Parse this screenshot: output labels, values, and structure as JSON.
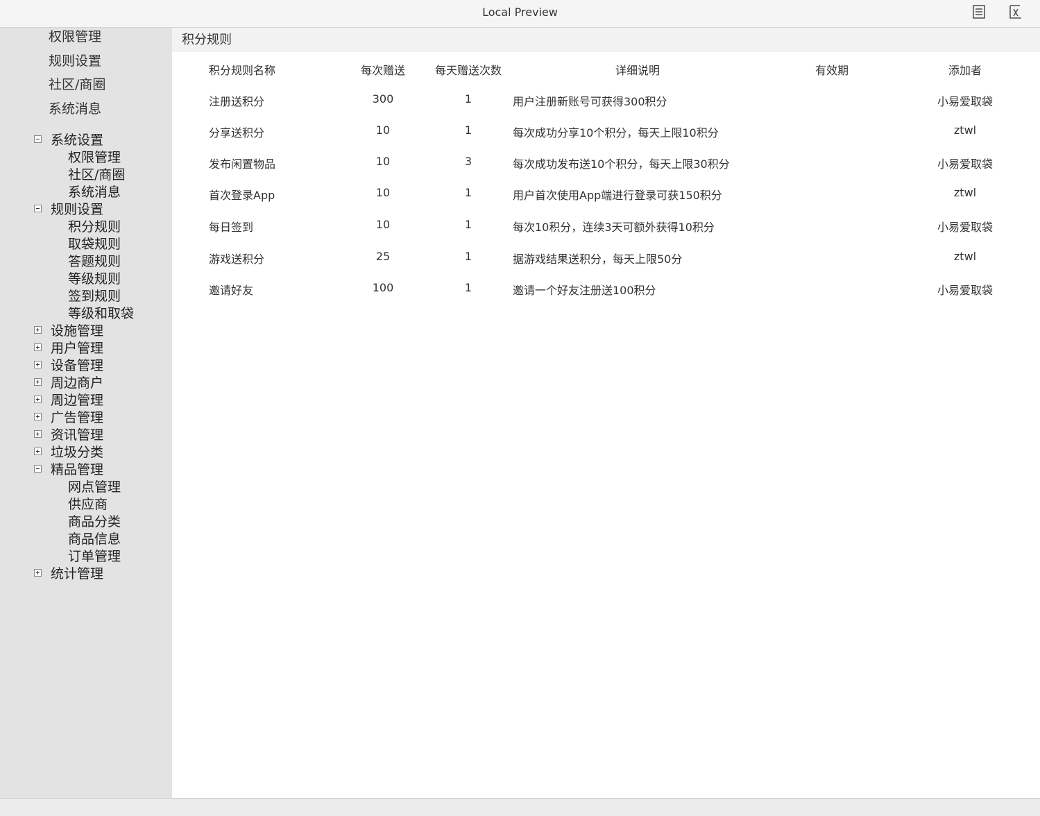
{
  "window": {
    "title": "Local Preview"
  },
  "sidebar": {
    "quick_links": [
      "权限管理",
      "规则设置",
      "社区/商圈",
      "系统消息"
    ],
    "tree": [
      {
        "label": "系统设置",
        "expanded": true,
        "children": [
          "权限管理",
          "社区/商圈",
          "系统消息"
        ]
      },
      {
        "label": "规则设置",
        "expanded": true,
        "children": [
          "积分规则",
          "取袋规则",
          "答题规则",
          "等级规则",
          "签到规则",
          "等级和取袋"
        ]
      },
      {
        "label": "设施管理",
        "expanded": false,
        "children": []
      },
      {
        "label": "用户管理",
        "expanded": false,
        "children": []
      },
      {
        "label": "设备管理",
        "expanded": false,
        "children": []
      },
      {
        "label": "周边商户",
        "expanded": false,
        "children": []
      },
      {
        "label": "周边管理",
        "expanded": false,
        "children": []
      },
      {
        "label": "广告管理",
        "expanded": false,
        "children": []
      },
      {
        "label": "资讯管理",
        "expanded": false,
        "children": []
      },
      {
        "label": "垃圾分类",
        "expanded": false,
        "children": []
      },
      {
        "label": "精品管理",
        "expanded": true,
        "children": [
          "网点管理",
          "供应商",
          "商品分类",
          "商品信息",
          "订单管理"
        ]
      },
      {
        "label": "统计管理",
        "expanded": false,
        "children": []
      }
    ]
  },
  "main": {
    "title": "积分规则",
    "table": {
      "headers": [
        "积分规则名称",
        "每次赠送",
        "每天赠送次数",
        "详细说明",
        "有效期",
        "添加者"
      ],
      "rows": [
        [
          "注册送积分",
          "300",
          "1",
          "用户注册新账号可获得300积分",
          "",
          "小易爱取袋"
        ],
        [
          "分享送积分",
          "10",
          "1",
          "每次成功分享10个积分，每天上限10积分",
          "",
          "ztwl"
        ],
        [
          "发布闲置物品",
          "10",
          "3",
          "每次成功发布送10个积分，每天上限30积分",
          "",
          "小易爱取袋"
        ],
        [
          "首次登录App",
          "10",
          "1",
          "用户首次使用App端进行登录可获150积分",
          "",
          "ztwl"
        ],
        [
          "每日签到",
          "10",
          "1",
          "每次10积分，连续3天可额外获得10积分",
          "",
          "小易爱取袋"
        ],
        [
          "游戏送积分",
          "25",
          "1",
          "据游戏结果送积分，每天上限50分",
          "",
          "ztwl"
        ],
        [
          "邀请好友",
          "100",
          "1",
          "邀请一个好友注册送100积分",
          "",
          "小易爱取袋"
        ]
      ]
    }
  },
  "icons": {
    "toolbar": [
      "notes-icon",
      "formula-icon"
    ]
  }
}
